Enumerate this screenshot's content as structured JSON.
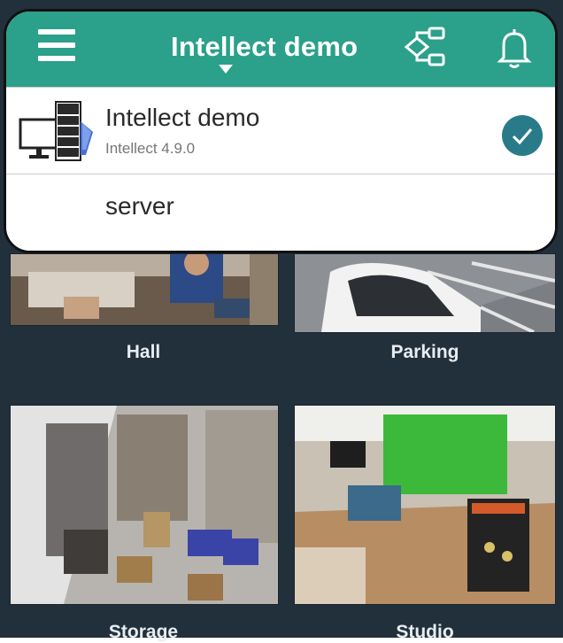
{
  "header": {
    "title": "Intellect demo",
    "menu_icon": "hamburger-icon",
    "layout_icon": "hierarchy-icon",
    "notifications_icon": "bell-icon",
    "accent": "#2ba08a"
  },
  "servers": {
    "selected": {
      "name": "Intellect demo",
      "version": "Intellect 4.9.0",
      "icon": "server-computer-icon",
      "status_icon": "check-icon",
      "status_color": "#2a7b8a"
    },
    "other": {
      "name": "server"
    }
  },
  "cameras": [
    {
      "label": "Hall"
    },
    {
      "label": "Parking"
    },
    {
      "label": "Storage"
    },
    {
      "label": "Studio"
    }
  ]
}
